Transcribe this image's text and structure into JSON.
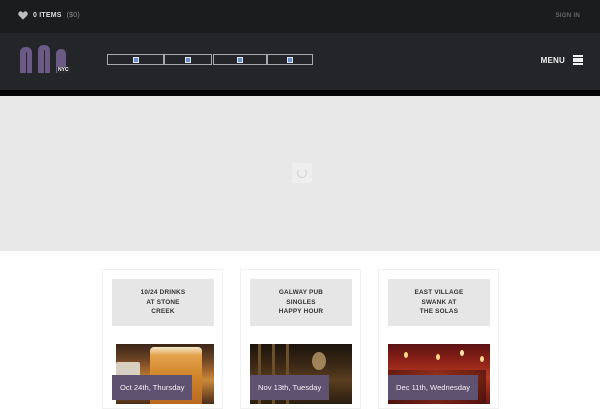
{
  "topbar": {
    "cart_label": "0 ITEMS",
    "cart_amount": "($0)",
    "signin_label": "SIGN IN",
    "cart_icon": "heart-icon"
  },
  "header": {
    "logo_text": "NYC",
    "social_icons": [
      "social-icon-1",
      "social-icon-2",
      "social-icon-3",
      "social-icon-4"
    ],
    "menu_label": "MENU",
    "menu_icon": "hamburger-icon"
  },
  "hero": {
    "loading_icon": "spinner-icon"
  },
  "events": [
    {
      "title": "10/24 DRINKS\nAT STONE\nCREEK",
      "date": "Oct 24th, Thursday"
    },
    {
      "title": "GALWAY PUB\nSINGLES\nHAPPY HOUR",
      "date": "Nov 13th, Tuesday"
    },
    {
      "title": "EAST VILLAGE\nSWANK AT\nTHE SOLAS",
      "date": "Dec 11th, Wednesday"
    }
  ],
  "colors": {
    "topbar_bg": "#1b1c1e",
    "header_bg": "#232528",
    "logo_purple": "#6b5a86",
    "date_badge_bg": "#5e5270",
    "hero_bg": "#e8e8e8"
  }
}
